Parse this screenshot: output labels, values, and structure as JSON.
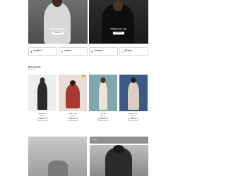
{
  "hero": {
    "left": {
      "title": "New Collection",
      "button": "Shop Now"
    },
    "right": {
      "title": "T-Shirts for Her",
      "button": "Shop Now"
    }
  },
  "features": [
    {
      "icon": "star-icon",
      "title": "Great BIG EXT",
      "subtitle": "lorem ipsum"
    },
    {
      "icon": "return-icon",
      "title": "Free Returns",
      "subtitle": "lorem ipsum"
    },
    {
      "icon": "truck-icon",
      "title": "Free Shipping",
      "subtitle": "lorem ipsum"
    },
    {
      "icon": "support-icon",
      "title": "24/7 Support",
      "subtitle": "lorem ipsum"
    }
  ],
  "new_arrivals": {
    "title": "New arrivals",
    "link": "Browse all",
    "products": [
      {
        "name": "Sweatshirt Blue",
        "price": "$29.99",
        "button": "Add to cart",
        "badge": ""
      },
      {
        "name": "Graphic T-shirt",
        "price": "$19.99",
        "button": "Add to cart",
        "badge": "NEW"
      },
      {
        "name": "Linen Shirt",
        "price": "$34.99",
        "button": "Add to cart",
        "badge": ""
      },
      {
        "name": "Hooded Jacket",
        "price": "$49.99",
        "button": "Add to cart",
        "badge": ""
      }
    ]
  },
  "promo": {
    "right_label": "Hoodies"
  }
}
